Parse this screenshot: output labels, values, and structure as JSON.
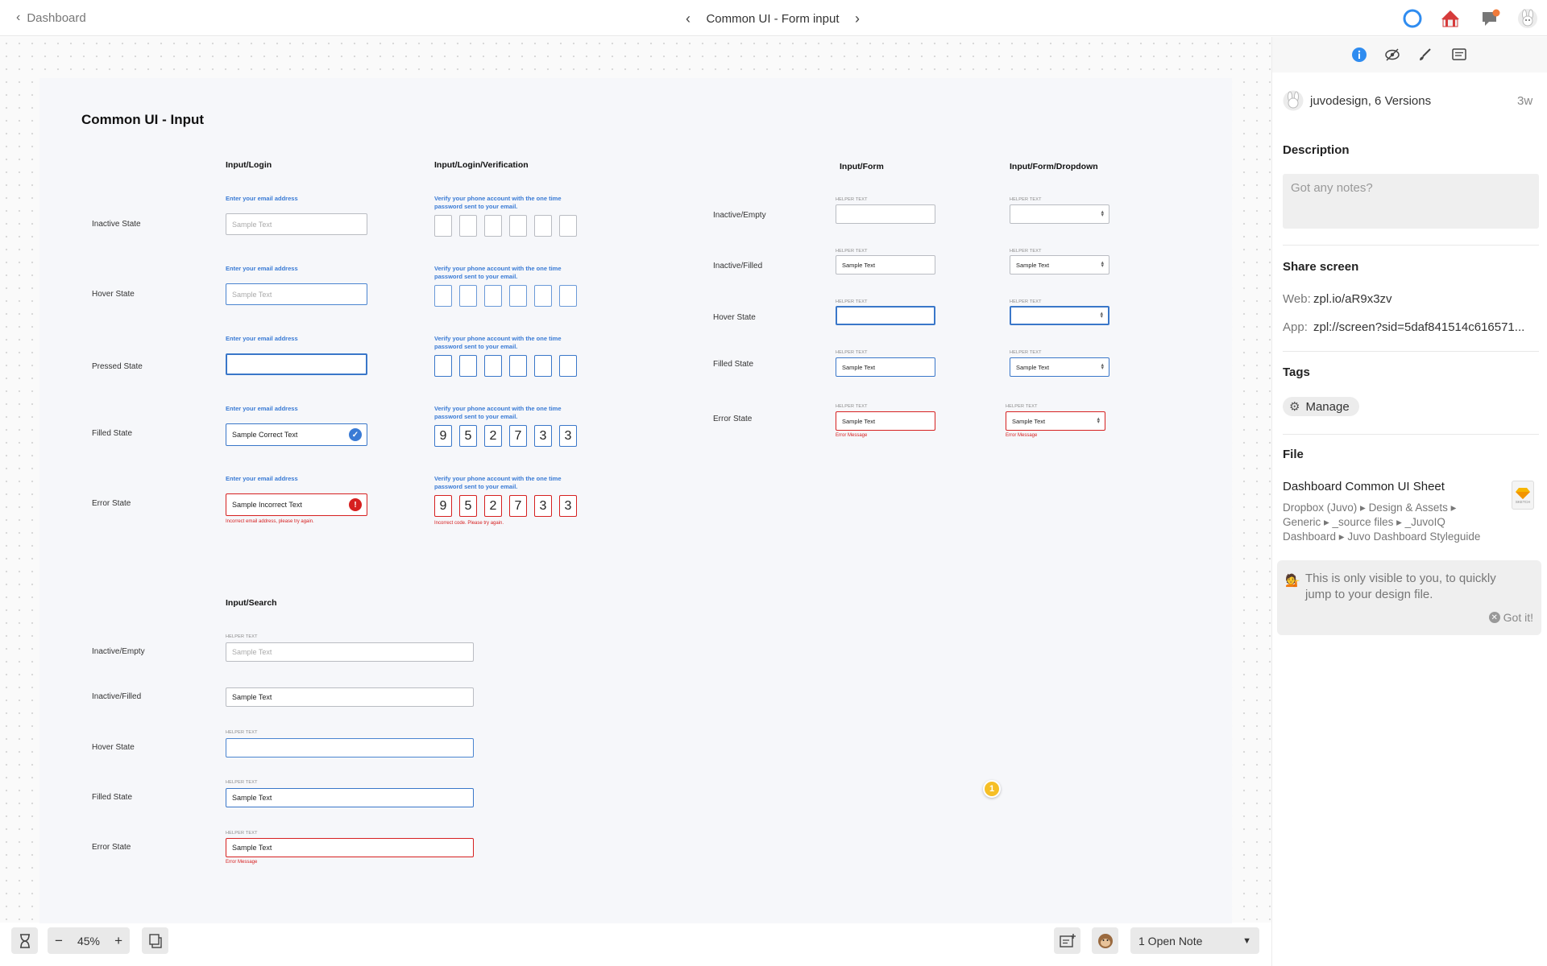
{
  "topbar": {
    "back_label": "Dashboard",
    "screen_title": "Common UI - Form input",
    "icons": [
      "sync-ring-icon",
      "circus-tent-icon",
      "notification-bell-icon",
      "user-avatar-bunny-icon"
    ]
  },
  "artboard": {
    "title": "Common UI -  Input",
    "login": {
      "title": "Input/Login",
      "prompt": "Enter your email address",
      "rows": [
        {
          "state": "Inactive State",
          "value": "Sample Text"
        },
        {
          "state": "Hover State",
          "value": "Sample Text"
        },
        {
          "state": "Pressed State",
          "value": ""
        },
        {
          "state": "Filled State",
          "value": "Sample Correct Text"
        },
        {
          "state": "Error State",
          "value": "Sample Incorrect Text"
        }
      ],
      "error_message": "Incorrect email address, please try again."
    },
    "verification": {
      "title": "Input/Login/Verification",
      "prompt_line1": "Verify your phone account with the one time",
      "prompt_line2": "password sent to your email.",
      "digits": [
        "9",
        "5",
        "2",
        "7",
        "3",
        "3"
      ],
      "error_message": "Incorrect code. Please try again."
    },
    "form": {
      "title": "Input/Form",
      "dropdown_title": "Input/Form/Dropdown",
      "helper": "HELPER TEXT",
      "rows": [
        {
          "state": "Inactive/Empty",
          "value": ""
        },
        {
          "state": "Inactive/Filled",
          "value": "Sample Text"
        },
        {
          "state": "Hover State",
          "value": ""
        },
        {
          "state": "Filled State",
          "value": "Sample Text"
        },
        {
          "state": "Error State",
          "value": "Sample Text"
        }
      ],
      "error_message": "Error Message"
    },
    "search": {
      "title": "Input/Search",
      "helper": "HELPER TEXT",
      "rows": [
        {
          "state": "Inactive/Empty",
          "value": "Sample Text"
        },
        {
          "state": "Inactive/Filled",
          "value": "Sample Text"
        },
        {
          "state": "Hover State",
          "value": ""
        },
        {
          "state": "Filled State",
          "value": "Sample Text"
        },
        {
          "state": "Error State",
          "value": "Sample Text"
        }
      ],
      "error_message": "Error Message"
    },
    "note_marker": "1"
  },
  "panel": {
    "tabs": [
      "info-icon",
      "hide-icon",
      "brush-icon",
      "notes-icon"
    ],
    "author": "juvodesign, 6 Versions",
    "age": "3w",
    "description_title": "Description",
    "description_placeholder": "Got any notes?",
    "share_title": "Share screen",
    "web_label": "Web:",
    "web_value": "zpl.io/aR9x3zv",
    "app_label": "App:",
    "app_value": "zpl://screen?sid=5daf841514c616571...",
    "tags_title": "Tags",
    "manage_label": "Manage",
    "file_title": "File",
    "file_name": "Dashboard Common UI Sheet",
    "file_path_1": "Dropbox (Juvo) ▸ Design & Assets ▸",
    "file_path_2": "Generic ▸ _source files ▸ _JuvoIQ",
    "file_path_3": "Dashboard ▸ Juvo Dashboard Styleguide",
    "sketch_label": "SKETCH",
    "tip_line1": "This is only visible to you, to quickly",
    "tip_line2": "jump to your design file.",
    "got_it": "Got it!"
  },
  "bottombar": {
    "zoom_minus": "−",
    "zoom_level": "45%",
    "zoom_plus": "+",
    "open_note": "1 Open Note"
  },
  "colors": {
    "accent_blue": "#3a77c9",
    "error_red": "#d62020",
    "check_blue": "#3a7bd5"
  }
}
